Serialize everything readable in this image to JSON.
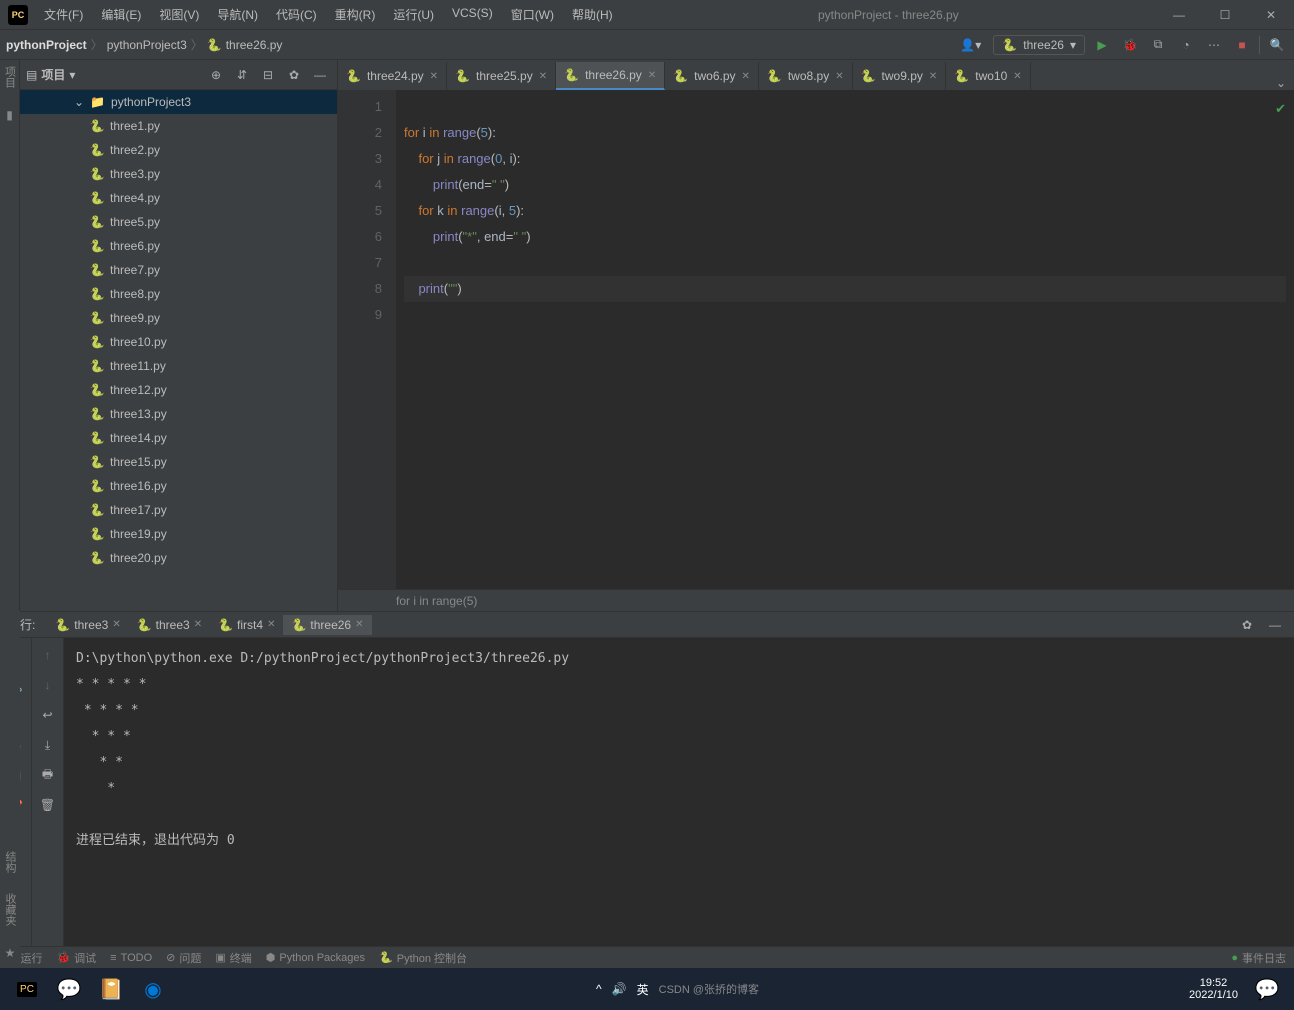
{
  "window": {
    "title": "pythonProject - three26.py",
    "minimize": "—",
    "maximize": "☐",
    "close": "✕"
  },
  "menubar": [
    "文件(F)",
    "编辑(E)",
    "视图(V)",
    "导航(N)",
    "代码(C)",
    "重构(R)",
    "运行(U)",
    "VCS(S)",
    "窗口(W)",
    "帮助(H)"
  ],
  "breadcrumbs": [
    "pythonProject",
    "pythonProject3",
    "three26.py"
  ],
  "run_config": "three26",
  "project_panel": {
    "title": "项目",
    "folder": "pythonProject3",
    "files": [
      "three1.py",
      "three2.py",
      "three3.py",
      "three4.py",
      "three5.py",
      "three6.py",
      "three7.py",
      "three8.py",
      "three9.py",
      "three10.py",
      "three11.py",
      "three12.py",
      "three13.py",
      "three14.py",
      "three15.py",
      "three16.py",
      "three17.py",
      "three19.py",
      "three20.py"
    ]
  },
  "editor_tabs": [
    {
      "name": "three24.py",
      "active": false
    },
    {
      "name": "three25.py",
      "active": false
    },
    {
      "name": "three26.py",
      "active": true
    },
    {
      "name": "two6.py",
      "active": false
    },
    {
      "name": "two8.py",
      "active": false
    },
    {
      "name": "two9.py",
      "active": false
    },
    {
      "name": "two10",
      "active": false
    }
  ],
  "code": {
    "lines": [
      {
        "n": 1,
        "html": ""
      },
      {
        "n": 2,
        "html": "<span class='kw'>for</span> <span class='id'>i</span> <span class='kw'>in</span> <span class='fn'>range</span>(<span class='num'>5</span>):"
      },
      {
        "n": 3,
        "html": "    <span class='kw'>for</span> <span class='id'>j</span> <span class='kw'>in</span> <span class='fn'>range</span>(<span class='num'>0</span>, <span class='id'>i</span>):"
      },
      {
        "n": 4,
        "html": "        <span class='fn'>print</span>(<span class='id'>end</span>=<span class='str'>\" \"</span>)"
      },
      {
        "n": 5,
        "html": "    <span class='kw'>for</span> <span class='id'>k</span> <span class='kw'>in</span> <span class='fn'>range</span>(<span class='id'>i</span>, <span class='num'>5</span>):"
      },
      {
        "n": 6,
        "html": "        <span class='fn'>print</span>(<span class='str'>\"*\"</span>, <span class='id'>end</span>=<span class='str'>\" \"</span>)"
      },
      {
        "n": 7,
        "html": ""
      },
      {
        "n": 8,
        "html": "    <span class='fn'>print</span>(<span class='str'>\"\"</span>)",
        "current": true
      },
      {
        "n": 9,
        "html": ""
      }
    ],
    "crumb": "for i in range(5)"
  },
  "run_panel": {
    "label": "运行:",
    "tabs": [
      {
        "name": "three3",
        "active": false
      },
      {
        "name": "three3",
        "active": false
      },
      {
        "name": "first4",
        "active": false
      },
      {
        "name": "three26",
        "active": true
      }
    ],
    "output": "D:\\python\\python.exe D:/pythonProject/pythonProject3/three26.py\n* * * * * \n * * * * \n  * * * \n   * * \n    * \n\n进程已结束，退出代码为 0"
  },
  "bottombar": {
    "run": "运行",
    "debug": "调试",
    "todo": "TODO",
    "problems": "问题",
    "terminal": "终端",
    "pypkg": "Python Packages",
    "pyconsole": "Python 控制台",
    "eventlog": "事件日志"
  },
  "leftgutter": {
    "label": "项目"
  },
  "leftbottom": {
    "l1": "结构",
    "l2": "收藏夹"
  },
  "taskbar": {
    "time": "19:52",
    "date": "2022/1/10",
    "lang": "英",
    "watermark": "CSDN @张挢的博客"
  }
}
